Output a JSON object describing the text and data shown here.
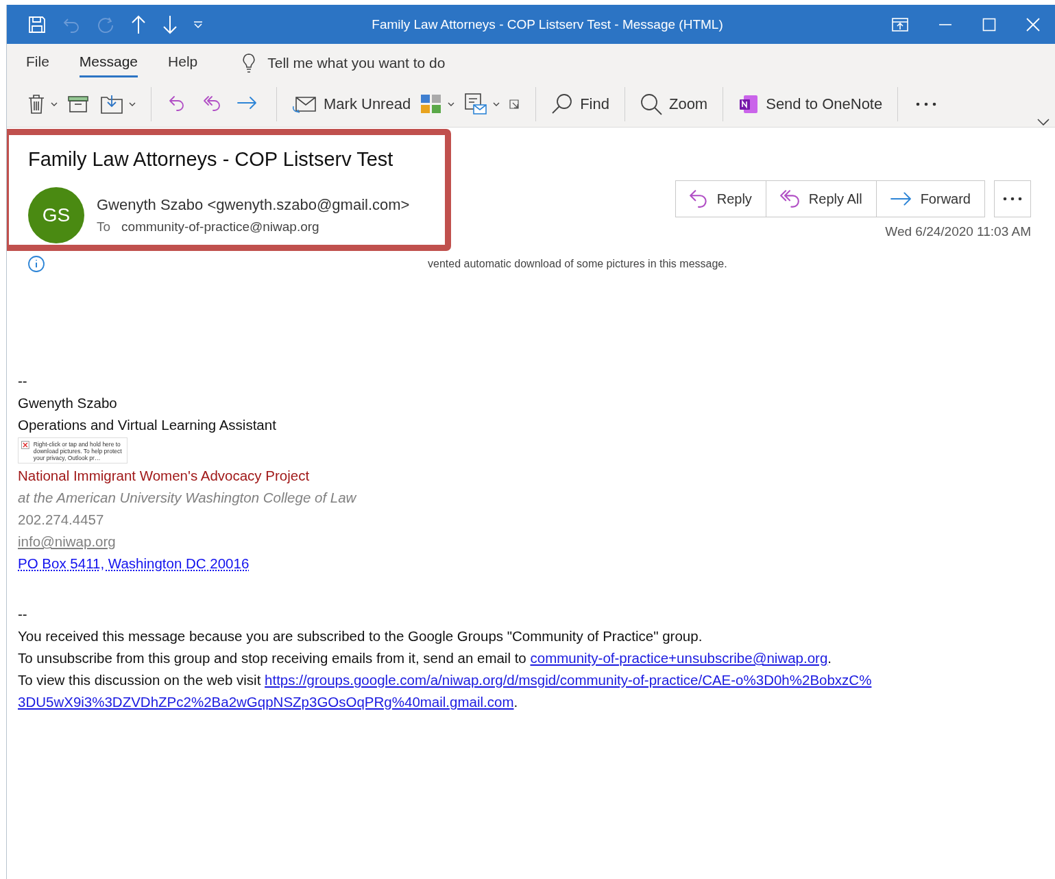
{
  "window": {
    "title": "Family Law Attorneys - COP Listserv Test  -  Message (HTML)"
  },
  "tabs": [
    {
      "label": "File",
      "selected": false
    },
    {
      "label": "Message",
      "selected": true
    },
    {
      "label": "Help",
      "selected": false
    }
  ],
  "tell_me": {
    "placeholder": "Tell me what you want to do"
  },
  "toolbar": {
    "labels": [
      "Mark Unread",
      "Find",
      "Zoom",
      "Send to OneNote"
    ]
  },
  "message": {
    "subject": "Family Law Attorneys - COP Listserv Test",
    "avatar": "GS",
    "sender": "Gwenyth Szabo <gwenyth.szabo@gmail.com>",
    "to_label": "To",
    "to": "community-of-practice@niwap.org",
    "actions": [
      {
        "label": "Reply"
      },
      {
        "label": "Reply All"
      },
      {
        "label": "Forward"
      }
    ],
    "date": "Wed 6/24/2020 11:03 AM",
    "info_bar": "vented automatic download of some pictures in this message."
  },
  "signature": [
    {
      "kind": "plain",
      "text": "--"
    },
    {
      "kind": "plain",
      "text": "Gwenyth Szabo"
    },
    {
      "kind": "plain",
      "text": "Operations and Virtual Learning Assistant"
    },
    {
      "kind": "blocked_image",
      "text": "Right-click or tap and hold here to download pictures. To help protect your privacy, Outlook pr…"
    },
    {
      "kind": "org",
      "text": "National Immigrant Women's Advocacy Project"
    },
    {
      "kind": "italic",
      "text": "at the American University Washington College of Law"
    },
    {
      "kind": "grey",
      "text": "202.274.4457"
    },
    {
      "kind": "grey_link",
      "text": "info@niwap.org"
    },
    {
      "kind": "address_link",
      "text": "PO Box 5411, Washington DC 20016"
    }
  ],
  "footer": {
    "separator": "--",
    "paragraphs": [
      {
        "text": "You received this message because you are subscribed to the Google Groups \"Community of Practice\" group."
      },
      {
        "text": "To unsubscribe from this group and stop receiving emails from it, send an email to ",
        "links": [
          "community-of-practice+unsubscribe@niwap.org"
        ],
        "after": "."
      },
      {
        "text": "To view this discussion on the web visit ",
        "links": [
          "https://groups.google.com/a/niwap.org/d/msgid/community-of-practice/CAE-o%3D0h%2BobxzC%",
          "3DU5wX9i3%3DZVDhZPc2%2Ba2wGqpNSZp3GOsOqPRg%40mail.gmail.com"
        ],
        "after": "."
      }
    ]
  }
}
